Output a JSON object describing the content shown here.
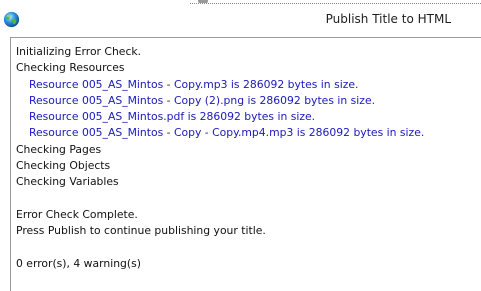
{
  "window": {
    "title": "Publish Title to HTML",
    "icon": "globe-icon"
  },
  "log": {
    "lines": [
      {
        "kind": "normal",
        "text": "Initializing Error Check."
      },
      {
        "kind": "normal",
        "text": "Checking Resources"
      },
      {
        "kind": "resource",
        "text": "Resource 005_AS_Mintos - Copy.mp3 is 286092 bytes in size."
      },
      {
        "kind": "resource",
        "text": "Resource 005_AS_Mintos - Copy (2).png is 286092 bytes in size."
      },
      {
        "kind": "resource",
        "text": "Resource 005_AS_Mintos.pdf is 286092 bytes in size."
      },
      {
        "kind": "resource",
        "text": "Resource 005_AS_Mintos - Copy - Copy.mp4.mp3 is 286092 bytes in size."
      },
      {
        "kind": "normal",
        "text": "Checking Pages"
      },
      {
        "kind": "normal",
        "text": "Checking Objects"
      },
      {
        "kind": "normal",
        "text": "Checking Variables"
      },
      {
        "kind": "blank",
        "text": ""
      },
      {
        "kind": "normal",
        "text": "Error Check Complete."
      },
      {
        "kind": "normal",
        "text": "Press Publish to continue publishing your title."
      },
      {
        "kind": "blank",
        "text": ""
      },
      {
        "kind": "normal",
        "text": "0 error(s), 4 warning(s)"
      }
    ]
  },
  "colors": {
    "resource_text": "#1a1ab8",
    "normal_text": "#111111",
    "panel_border": "#9a9a9a"
  }
}
